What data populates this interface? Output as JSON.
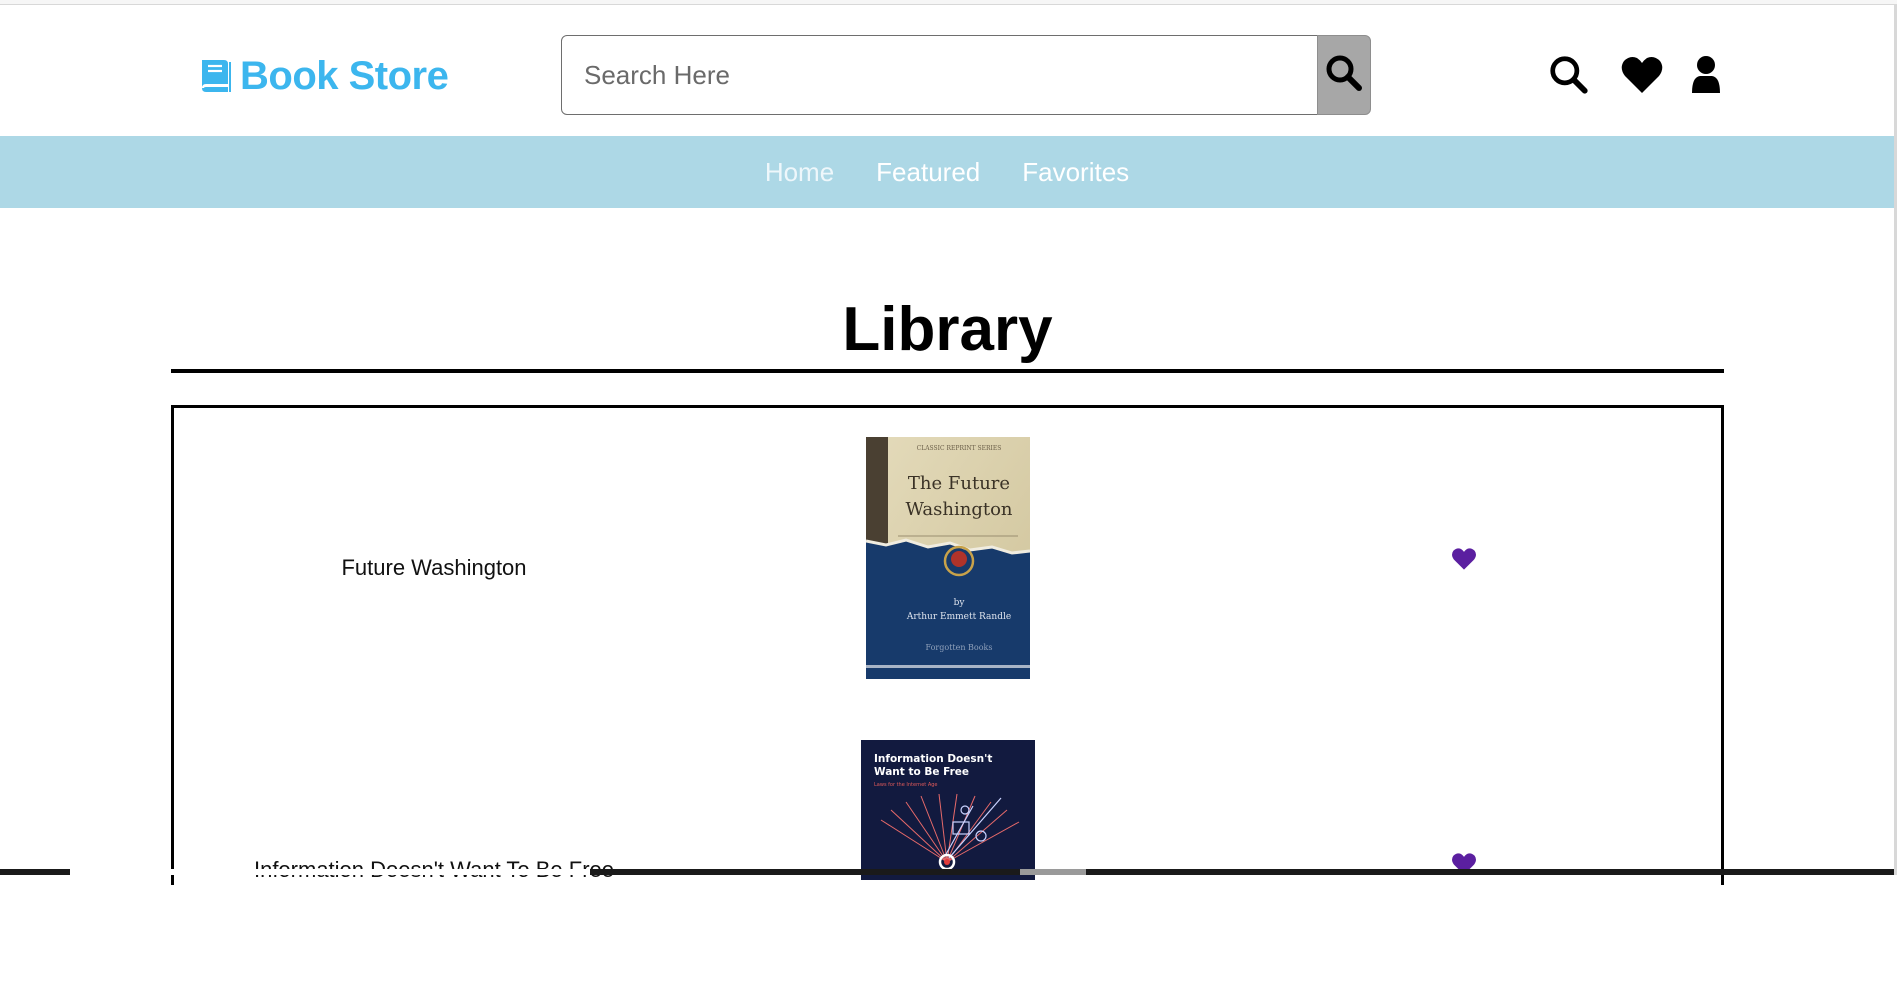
{
  "header": {
    "logo_text": "Book Store",
    "search": {
      "placeholder": "Search Here",
      "value": ""
    },
    "icons": [
      "search-icon",
      "heart-icon",
      "user-icon"
    ]
  },
  "nav": {
    "items": [
      {
        "label": "Home"
      },
      {
        "label": "Featured"
      },
      {
        "label": "Favorites"
      }
    ]
  },
  "main": {
    "title": "Library",
    "books": [
      {
        "title": "Future Washington",
        "cover": {
          "series": "CLASSIC REPRINT SERIES",
          "heading_line1": "The Future",
          "heading_line2": "Washington",
          "by": "by",
          "author": "Arthur Emmett Randle",
          "publisher": "Forgotten Books"
        }
      },
      {
        "title": "Information Doesn't Want To Be Free",
        "cover": {
          "heading_line1": "Information Doesn't",
          "heading_line2": "Want to Be Free",
          "subtitle": "Laws for the Internet Age"
        }
      }
    ]
  },
  "colors": {
    "brand": "#3cb6ee",
    "nav_bg": "#add8e6",
    "heart": "#5b1fa0",
    "search_button": "#a7a7a7"
  }
}
